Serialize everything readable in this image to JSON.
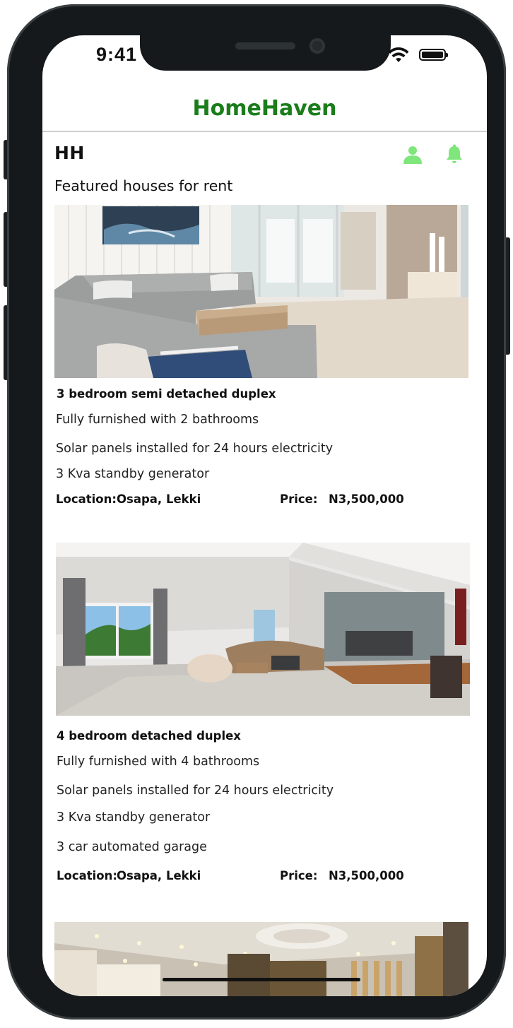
{
  "status_bar": {
    "time": "9:41"
  },
  "header": {
    "title": "HomeHaven"
  },
  "toolbar": {
    "brand": "HH",
    "user_icon": "user-icon",
    "bell_icon": "bell-icon"
  },
  "colors": {
    "brand_green": "#1a7d1a",
    "icon_green": "#7ee67a"
  },
  "section_title": "Featured houses for rent",
  "listings": [
    {
      "title": "3 bedroom semi detached duplex",
      "features": [
        "Fully furnished with 2 bathrooms",
        "Solar panels installed for 24 hours electricity",
        "3 Kva standby generator"
      ],
      "location_label": "Location:",
      "location": "Osapa, Lekki",
      "price_label": "Price:",
      "price": "N3,500,000"
    },
    {
      "title": "4 bedroom detached duplex",
      "features": [
        "Fully furnished with 4 bathrooms",
        "Solar panels installed for 24 hours electricity",
        "3 Kva standby generator",
        "3 car automated garage"
      ],
      "location_label": "Location:",
      "location": "Osapa, Lekki",
      "price_label": "Price:",
      "price": "N3,500,000"
    }
  ]
}
